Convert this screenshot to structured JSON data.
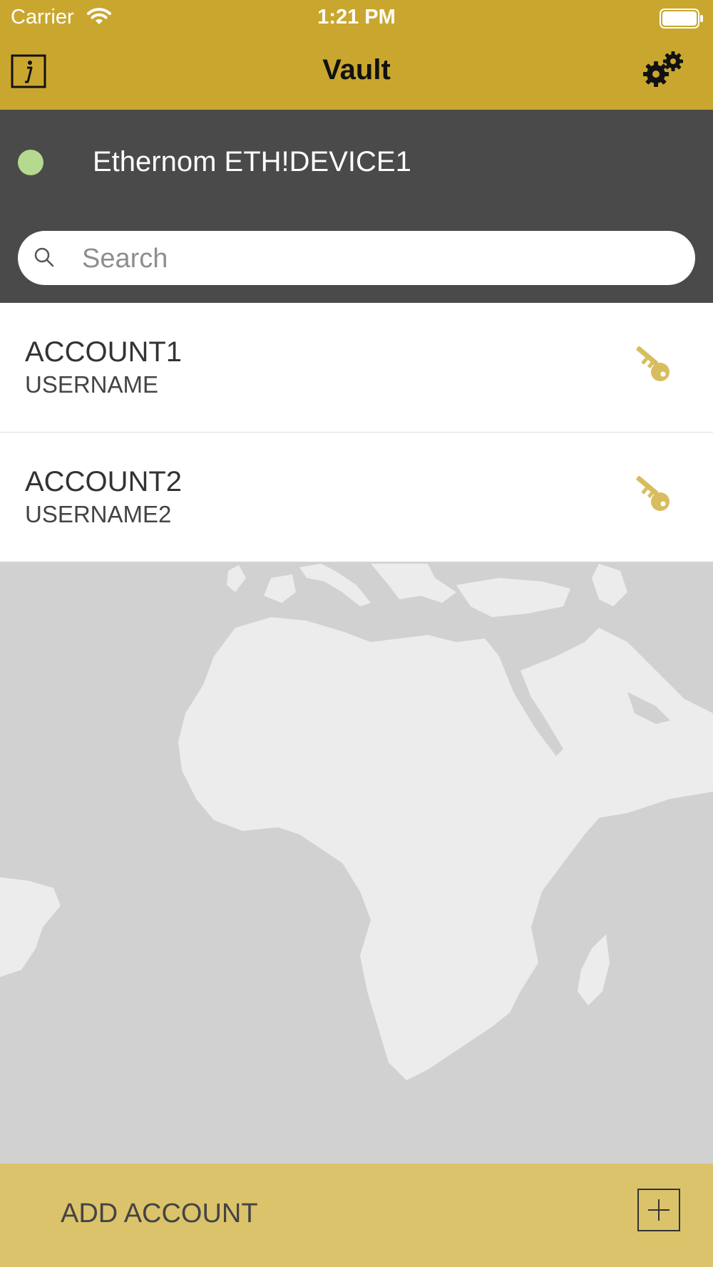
{
  "status_bar": {
    "carrier": "Carrier",
    "time": "1:21 PM"
  },
  "nav": {
    "title": "Vault",
    "info_icon": "info-icon",
    "settings_icon": "gears-icon"
  },
  "device": {
    "name": "Ethernom ETH!DEVICE1",
    "status_color": "#b5d98f"
  },
  "search": {
    "placeholder": "Search",
    "value": ""
  },
  "accounts": [
    {
      "name": "ACCOUNT1",
      "username": "USERNAME",
      "icon": "key-icon"
    },
    {
      "name": "ACCOUNT2",
      "username": "USERNAME2",
      "icon": "key-icon"
    }
  ],
  "footer": {
    "add_label": "ADD ACCOUNT",
    "add_icon": "plus-icon"
  },
  "colors": {
    "brand": "#c9a72f",
    "footer": "#dbc36b",
    "key": "#d8bd5e",
    "panel": "#4a4a4a"
  }
}
